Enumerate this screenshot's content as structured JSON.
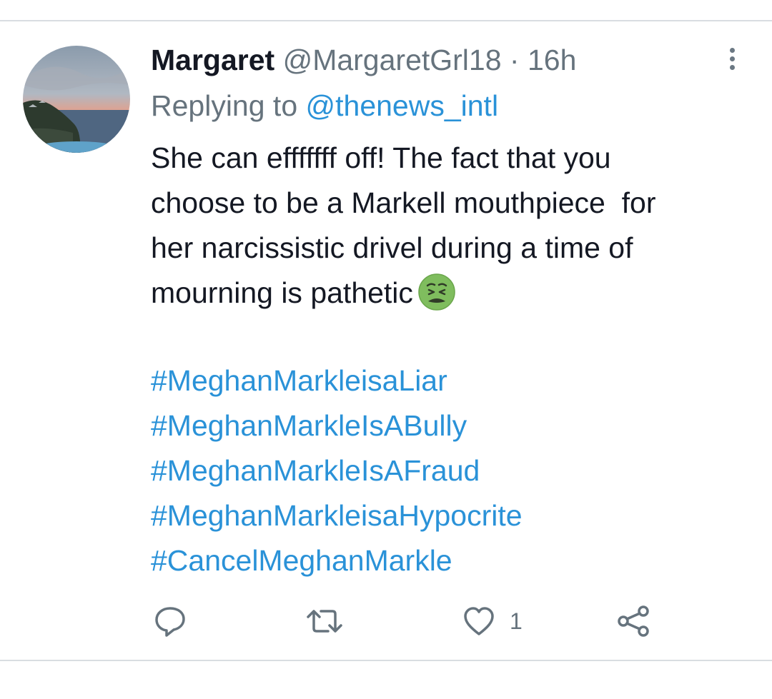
{
  "tweet": {
    "display_name": "Margaret",
    "handle": "@MargaretGrl18",
    "separator": " · ",
    "time": "16h",
    "replying_prefix": "Replying to ",
    "replying_to": "@thenews_intl",
    "body_lines": [
      "She can efffffff off! The fact that you",
      "choose to be a Markell mouthpiece  for",
      "her narcissistic drivel during a time of",
      "mourning is pathetic"
    ],
    "emoji": "nauseated-face",
    "hashtags": [
      "#MeghanMarkleisaLiar",
      "#MeghanMarkleIsABully",
      "#MeghanMarkleIsAFraud",
      "#MeghanMarkleisaHypocrite",
      "#CancelMeghanMarkle"
    ]
  },
  "actions": {
    "reply_icon": "reply-icon",
    "retweet_icon": "retweet-icon",
    "like_icon": "heart-icon",
    "like_count": "1",
    "share_icon": "share-icon"
  },
  "colors": {
    "link": "#2a92d8",
    "muted": "#66737d",
    "text": "#141823",
    "divider": "#d9dde1"
  }
}
